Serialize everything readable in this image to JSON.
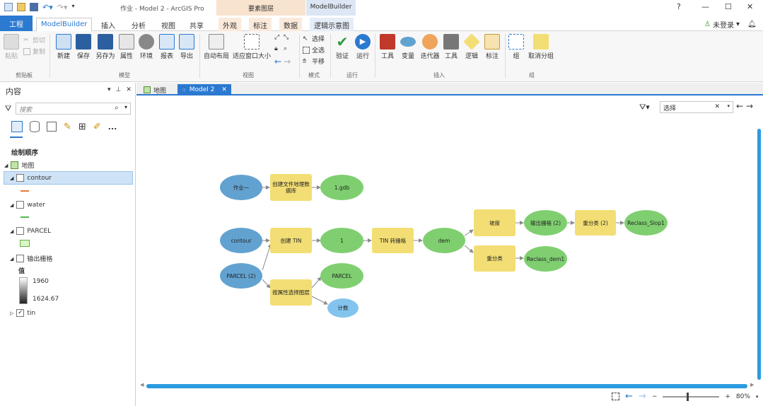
{
  "window": {
    "title": "作业 - Model 2 - ArcGIS Pro",
    "context_feature_layer": "要素图层",
    "context_modelbuilder": "ModelBuilder",
    "help": "?",
    "minimize": "—",
    "maximize": "☐",
    "close": "✕"
  },
  "tabs": {
    "project": "工程",
    "items": [
      "ModelBuilder",
      "插入",
      "分析",
      "视图",
      "共享",
      "外观",
      "标注",
      "数据",
      "逻辑示意图"
    ],
    "user": "未登录",
    "user_icon": "person-icon"
  },
  "ribbon": {
    "clipboard": {
      "paste": "粘贴",
      "cut": "剪切",
      "copy": "复制",
      "group": "剪贴板"
    },
    "model": {
      "new": "新建",
      "save": "保存",
      "save_as": "另存为",
      "properties": "属性",
      "environments": "环境",
      "report": "报表",
      "export": "导出",
      "group": "模型"
    },
    "view": {
      "auto_layout": "自动布局",
      "fit_to_window": "适应窗口大小",
      "group": "视图"
    },
    "mode": {
      "select": "选择",
      "select_all": "全选",
      "pan": "平移",
      "group": "模式"
    },
    "run": {
      "validate": "验证",
      "run": "运行",
      "group": "运行"
    },
    "insert": {
      "tools": "工具",
      "variable": "变量",
      "iterators": "迭代器",
      "utilities": "工具",
      "logic": "逻辑",
      "label": "标注",
      "group": "插入"
    },
    "group_grp": {
      "group": "组",
      "ungroup": "取消分组",
      "grouplabel": "组"
    }
  },
  "contents": {
    "title": "内容",
    "search_placeholder": "搜索",
    "drawing_order": "绘制顺序",
    "map": "地图",
    "layers": [
      {
        "name": "contour",
        "checked": false
      },
      {
        "name": "water",
        "checked": false
      },
      {
        "name": "PARCEL",
        "checked": false
      },
      {
        "name": "输出栅格",
        "checked": false
      },
      {
        "name": "tin",
        "checked": true
      }
    ],
    "value_label": "值",
    "value_high": "1960",
    "value_low": "1624.67",
    "more": "..."
  },
  "doc_tabs": {
    "map": "地图",
    "model": "Model 2",
    "close": "✕"
  },
  "canvas": {
    "filter_select": "选择",
    "zoom": "80%",
    "nodes": {
      "n1": "作业一",
      "n2": "创建文件地理数据库",
      "n3": "1.gdb",
      "n4": "contour",
      "n5": "创建 TIN",
      "n6": "1",
      "n7": "TIN 转栅格",
      "n8": "dem",
      "n9": "坡度",
      "n10": "输出栅格 (2)",
      "n11": "重分类 (2)",
      "n12": "Reclass_Slop1",
      "n13": "重分类",
      "n14": "Reclass_dem1",
      "n15": "PARCEL (2)",
      "n16": "按属性选择图层",
      "n17": "PARCEL",
      "n18": "计数"
    }
  },
  "colors": {
    "accent": "#2b79d0",
    "input_var": "#62a2d0",
    "tool": "#f2de74",
    "output_var": "#7fcf70",
    "light_var": "#82c4ee"
  }
}
